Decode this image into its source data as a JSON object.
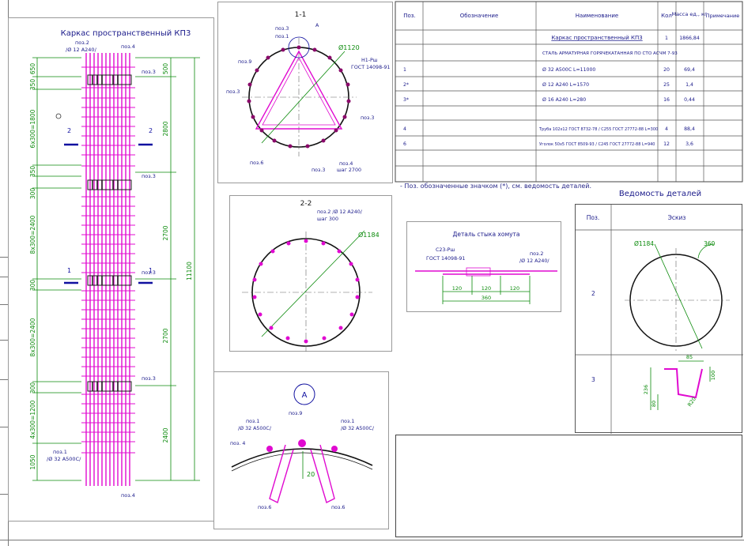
{
  "frame_title": "Каркас пространственный КП3",
  "cage": {
    "top_labels": {
      "pos2": "поз.2",
      "pos2_spec": "/Ø 12 А240/",
      "pos4_top": "поз.4"
    },
    "pos3_labels": [
      "поз.3",
      "поз.3",
      "поз.3",
      "поз.3"
    ],
    "bottom_labels": {
      "pos1": "поз.1",
      "pos1_spec": "/Ø 32 А500С/",
      "pos4_bottom": "поз.4"
    },
    "left_dims": [
      "650",
      "350",
      "6х300=1800",
      "350",
      "300",
      "8х300=2400",
      "300",
      "8х300=2400",
      "300",
      "4х300=1200",
      "1050"
    ],
    "right_dims": [
      "500",
      "2800",
      "2700",
      "2700",
      "2400"
    ],
    "overall_dim": "11100",
    "section_marks": {
      "s2": "2",
      "s1": "1"
    }
  },
  "section_1_1": {
    "title": "1-1",
    "callout": "А",
    "pos3": "поз.3",
    "pos1": "поз.1",
    "pos9": "поз.9",
    "diam": "Ø1120",
    "weld_top": "Н1-Рш",
    "weld_gost": "ГОСТ 14098-91",
    "pos3b": "поз.3",
    "pos6": "поз.6",
    "pos3c": "поз.3",
    "pos4": "поз.4",
    "pos4_spec": "шаг 2700"
  },
  "section_2_2": {
    "title": "2-2",
    "pos2": "поз.2 /Ø 12 А240/",
    "step": "шаг 300",
    "diam": "Ø1184"
  },
  "detail_a": {
    "callout": "А",
    "pos9": "поз.9",
    "pos1_left": "поз.1",
    "pos1_left_spec": "/Ø 32 А500С/",
    "pos1_right": "поз.1",
    "pos1_right_spec": "/Ø 32 А500С/",
    "pos4": "поз. 4",
    "dim": "20",
    "pos6_left": "поз.6",
    "pos6_right": "поз.6"
  },
  "joint_detail": {
    "title": "Деталь стыка хомута",
    "weld": "С23-Рш",
    "gost": "ГОСТ 14098-91",
    "pos2": "поз.2",
    "pos2_spec": "/Ø 12 А240/",
    "dims": [
      "120",
      "120",
      "120"
    ],
    "total": "360"
  },
  "spec_table": {
    "headers": [
      "Поз.",
      "Обозначение",
      "Наименование",
      "Кол",
      "Масса ед., кг",
      "Примечание"
    ],
    "rows": [
      {
        "pos": "",
        "designation": "",
        "name": "Каркас пространственный КП3",
        "qty": "1",
        "mass": "1866,84",
        "note": ""
      },
      {
        "pos": "",
        "designation": "",
        "name": "СТАЛЬ АРМАТУРНАЯ ГОРЯЧЕКАТАННАЯ ПО СТО АСЧМ 7-93",
        "qty": "",
        "mass": "",
        "note": ""
      },
      {
        "pos": "1",
        "designation": "",
        "name": "Ø 32 А500С L=11000",
        "qty": "20",
        "mass": "69,4",
        "note": ""
      },
      {
        "pos": "2*",
        "designation": "",
        "name": "Ø 12 А240 L=1570",
        "qty": "25",
        "mass": "1,4",
        "note": ""
      },
      {
        "pos": "3*",
        "designation": "",
        "name": "Ø 16 А240 L=280",
        "qty": "16",
        "mass": "0,44",
        "note": ""
      },
      {
        "pos": "",
        "designation": "",
        "name": "",
        "qty": "",
        "mass": "",
        "note": ""
      },
      {
        "pos": "4",
        "designation": "",
        "name": "Труба  102х12 ГОСТ 8732-78 / С255 ГОСТ 27772-88  L=300",
        "qty": "4",
        "mass": "88,4",
        "note": ""
      },
      {
        "pos": "6",
        "designation": "",
        "name": "Уголок  50х5 ГОСТ 8509-93 / С245 ГОСТ 27772-88  L=940",
        "qty": "12",
        "mass": "3,6",
        "note": ""
      },
      {
        "pos": "",
        "designation": "",
        "name": "",
        "qty": "",
        "mass": "",
        "note": ""
      },
      {
        "pos": "",
        "designation": "",
        "name": "",
        "qty": "",
        "mass": "",
        "note": ""
      }
    ]
  },
  "note_text": "- Поз. обозначенные значком (*), см. ведомость деталей.",
  "detail_sheet": {
    "title": "Ведомость деталей",
    "headers": [
      "Поз.",
      "Эскиз"
    ],
    "rows": [
      {
        "pos": "2",
        "diam": "Ø1184",
        "lap": "360"
      },
      {
        "pos": "3",
        "d1": "85",
        "d2": "100",
        "d3": "236",
        "d4": "80",
        "d5": "R20"
      }
    ]
  },
  "colors": {
    "rebar": "#e00ad0",
    "dim": "#0a8a0a",
    "marks": "#1010a0",
    "text": "#1a1a8a",
    "line": "#222222"
  }
}
